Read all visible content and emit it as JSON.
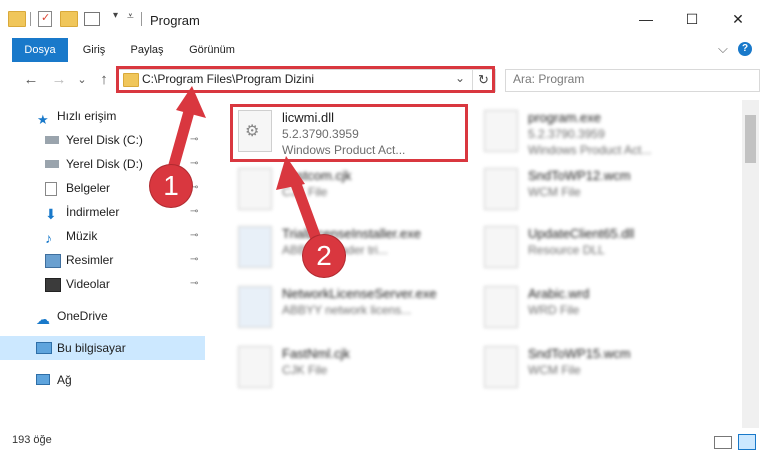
{
  "window": {
    "title": "Program",
    "minimize_glyph": "—",
    "maximize_glyph": "☐",
    "close_glyph": "✕"
  },
  "ribbon": {
    "tabs": [
      "Dosya",
      "Giriş",
      "Paylaş",
      "Görünüm"
    ],
    "expand_glyph": "⌵",
    "help_glyph": "?"
  },
  "nav": {
    "back_glyph": "←",
    "forward_glyph": "→",
    "recent_glyph": "⌄",
    "up_glyph": "↑"
  },
  "address": {
    "path": "C:\\Program Files\\Program Dizini",
    "dropdown_glyph": "⌄",
    "refresh_glyph": "↻"
  },
  "search": {
    "placeholder": "Ara: Program"
  },
  "sidebar": {
    "items": [
      {
        "label": "Hızlı erişim",
        "icon": "star-icon",
        "pinned": false
      },
      {
        "label": "Yerel Disk (C:)",
        "icon": "drive-icon",
        "pinned": true
      },
      {
        "label": "Yerel Disk (D:)",
        "icon": "drive-icon",
        "pinned": true
      },
      {
        "label": "Belgeler",
        "icon": "documents-icon",
        "pinned": true
      },
      {
        "label": "İndirmeler",
        "icon": "download-icon",
        "pinned": true
      },
      {
        "label": "Müzik",
        "icon": "music-icon",
        "pinned": true
      },
      {
        "label": "Resimler",
        "icon": "pictures-icon",
        "pinned": true
      },
      {
        "label": "Videolar",
        "icon": "video-icon",
        "pinned": true
      },
      {
        "label": "OneDrive",
        "icon": "cloud-icon",
        "pinned": false
      },
      {
        "label": "Bu bilgisayar",
        "icon": "computer-icon",
        "pinned": false
      },
      {
        "label": "Ağ",
        "icon": "network-icon",
        "pinned": false
      }
    ],
    "pin_glyph": "📌"
  },
  "files": [
    {
      "name": "licwmi.dll",
      "line2": "5.2.3790.3959",
      "line3": "Windows Product Act..."
    },
    {
      "name": "program.exe",
      "line2": "5.2.3790.3959",
      "line3": "Windows Product Act..."
    },
    {
      "name": "Fastcom.cjk",
      "line2": "CJK File",
      "line3": ""
    },
    {
      "name": "SndToWP12.wcm",
      "line2": "WCM File",
      "line3": ""
    },
    {
      "name": "TrialLicenseInstaller.exe",
      "line2": "ABBYY Reader tri...",
      "line3": ""
    },
    {
      "name": "UpdateClient65.dll",
      "line2": "Resource DLL",
      "line3": ""
    },
    {
      "name": "NetworkLicenseServer.exe",
      "line2": "ABBYY network licens...",
      "line3": ""
    },
    {
      "name": "Arabic.wrd",
      "line2": "WRD File",
      "line3": ""
    },
    {
      "name": "FastNml.cjk",
      "line2": "CJK File",
      "line3": ""
    },
    {
      "name": "SndToWP15.wcm",
      "line2": "WCM File",
      "line3": ""
    }
  ],
  "status": {
    "count": "193 öğe"
  },
  "annotations": {
    "step1": "1",
    "step2": "2",
    "color": "#d9373f"
  }
}
